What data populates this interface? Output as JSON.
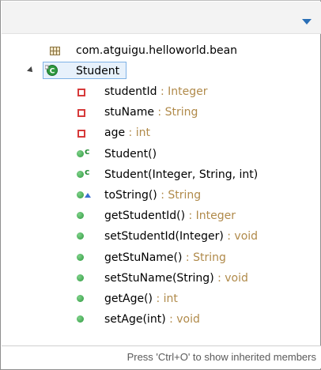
{
  "outline": {
    "package": "com.atguigu.helloworld.bean",
    "class_name": "Student",
    "members": [
      {
        "kind": "field",
        "name": "studentId",
        "type": " : Integer",
        "icon": "private-field-icon"
      },
      {
        "kind": "field",
        "name": "stuName",
        "type": " : String",
        "icon": "private-field-icon"
      },
      {
        "kind": "field",
        "name": "age",
        "type": " : int",
        "icon": "private-field-icon"
      },
      {
        "kind": "constructor",
        "name": "Student()",
        "type": "",
        "icon": "public-constructor-icon"
      },
      {
        "kind": "constructor",
        "name": "Student(Integer, String, int)",
        "type": "",
        "icon": "public-constructor-icon"
      },
      {
        "kind": "override",
        "name": "toString()",
        "type": " : String",
        "icon": "override-method-icon"
      },
      {
        "kind": "method",
        "name": "getStudentId()",
        "type": " : Integer",
        "icon": "public-method-icon"
      },
      {
        "kind": "method",
        "name": "setStudentId(Integer)",
        "type": " : void",
        "icon": "public-method-icon"
      },
      {
        "kind": "method",
        "name": "getStuName()",
        "type": " : String",
        "icon": "public-method-icon"
      },
      {
        "kind": "method",
        "name": "setStuName(String)",
        "type": " : void",
        "icon": "public-method-icon"
      },
      {
        "kind": "method",
        "name": "getAge()",
        "type": " : int",
        "icon": "public-method-icon"
      },
      {
        "kind": "method",
        "name": "setAge(int)",
        "type": " : void",
        "icon": "public-method-icon"
      }
    ]
  },
  "status": {
    "hint": "Press 'Ctrl+O' to show inherited members"
  },
  "colors": {
    "type_text": "#b08a4a",
    "field_icon": "#d63a3a",
    "method_icon": "#2e9a3f",
    "selection_bg": "#e7f1fb",
    "selection_border": "#7fb2e5",
    "menu_arrow": "#2a6fb6"
  }
}
